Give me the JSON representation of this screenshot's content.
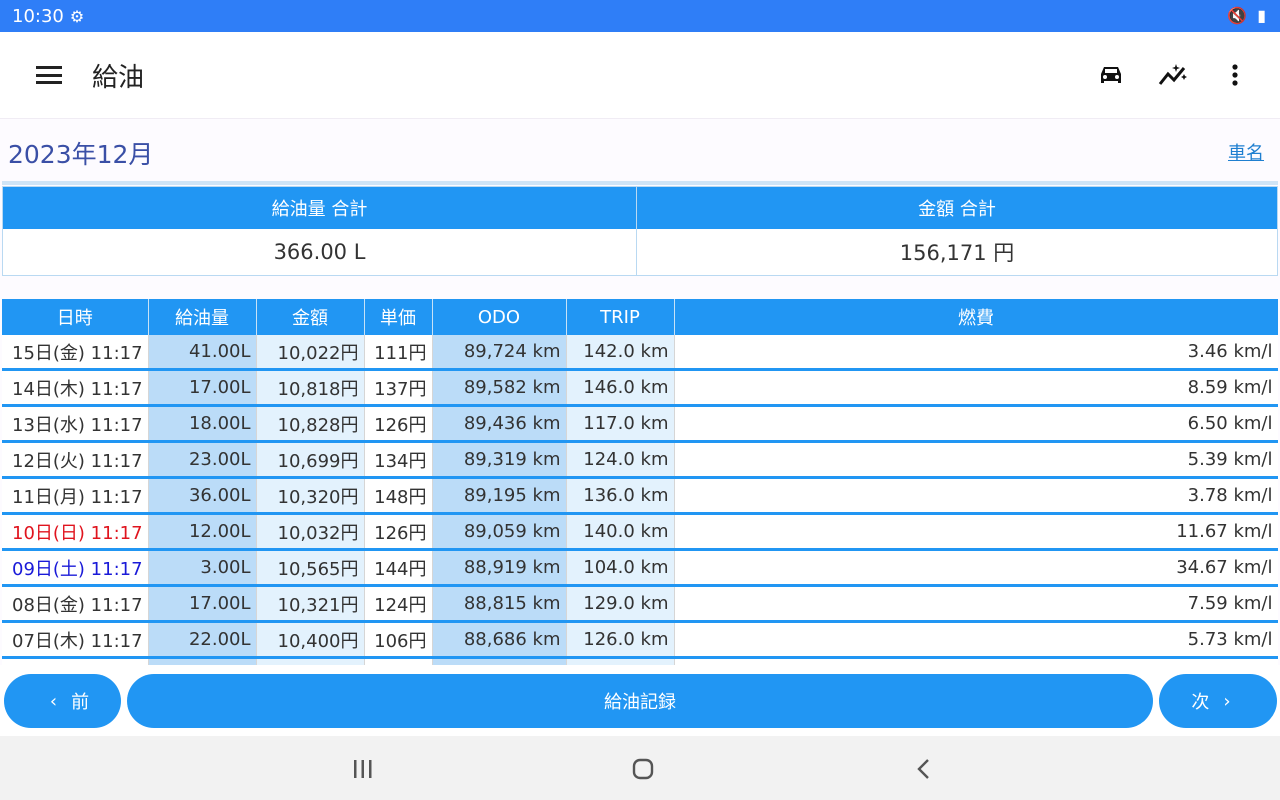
{
  "status_bar": {
    "time": "10:30"
  },
  "app_bar": {
    "title": "給油"
  },
  "header": {
    "month": "2023年12月",
    "car_link": "車名"
  },
  "summary": {
    "volume_label": "給油量 合計",
    "volume_value": "366.00 L",
    "amount_label": "金額 合計",
    "amount_value": "156,171 円"
  },
  "table": {
    "columns": [
      "日時",
      "給油量",
      "金額",
      "単価",
      "ODO",
      "TRIP",
      "燃費"
    ],
    "rows": [
      [
        "15日(金) 11:17",
        "41.00L",
        "10,022円",
        "111円",
        "89,724 km",
        "142.0 km",
        "3.46 km/l"
      ],
      [
        "14日(木) 11:17",
        "17.00L",
        "10,818円",
        "137円",
        "89,582 km",
        "146.0 km",
        "8.59 km/l"
      ],
      [
        "13日(水) 11:17",
        "18.00L",
        "10,828円",
        "126円",
        "89,436 km",
        "117.0 km",
        "6.50 km/l"
      ],
      [
        "12日(火) 11:17",
        "23.00L",
        "10,699円",
        "134円",
        "89,319 km",
        "124.0 km",
        "5.39 km/l"
      ],
      [
        "11日(月) 11:17",
        "36.00L",
        "10,320円",
        "148円",
        "89,195 km",
        "136.0 km",
        "3.78 km/l"
      ],
      [
        "10日(日) 11:17",
        "12.00L",
        "10,032円",
        "126円",
        "89,059 km",
        "140.0 km",
        "11.67 km/l"
      ],
      [
        "09日(土) 11:17",
        "3.00L",
        "10,565円",
        "144円",
        "88,919 km",
        "104.0 km",
        "34.67 km/l"
      ],
      [
        "08日(金) 11:17",
        "17.00L",
        "10,321円",
        "124円",
        "88,815 km",
        "129.0 km",
        "7.59 km/l"
      ],
      [
        "07日(木) 11:17",
        "22.00L",
        "10,400円",
        "106円",
        "88,686 km",
        "126.0 km",
        "5.73 km/l"
      ]
    ]
  },
  "footer": {
    "prev_label": "前",
    "main_label": "給油記録",
    "next_label": "次"
  },
  "colors": {
    "primary": "#2196f3",
    "status_bar": "#2f7ef7",
    "sunday": "#e0141e",
    "saturday": "#1a1ad8"
  },
  "icons": [
    "menu-icon",
    "car-icon",
    "sparkle-chart-icon",
    "more-vert-icon"
  ]
}
